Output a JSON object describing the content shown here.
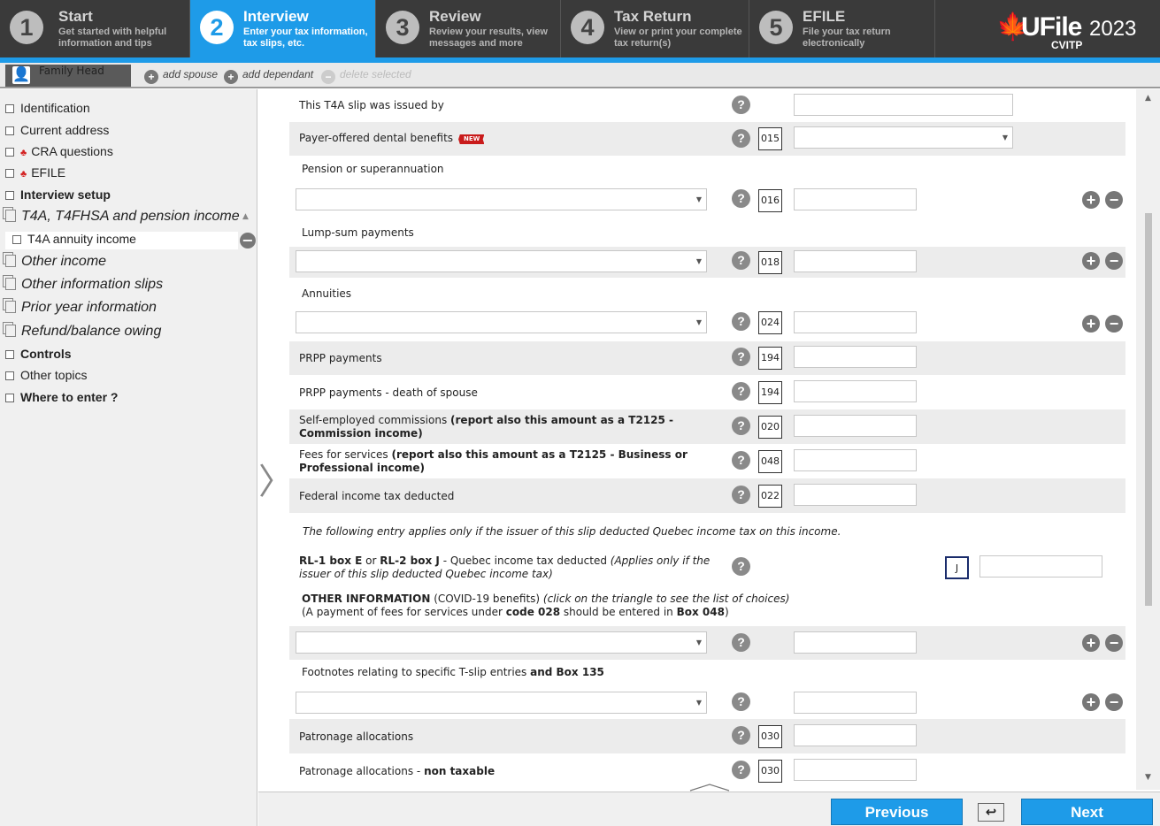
{
  "steps": [
    {
      "num": "1",
      "title": "Start",
      "sub": "Get started with helpful\ninformation and tips"
    },
    {
      "num": "2",
      "title": "Interview",
      "sub": "Enter your tax information,\ntax slips, etc."
    },
    {
      "num": "3",
      "title": "Review",
      "sub": "Review your results, view\nmessages and more"
    },
    {
      "num": "4",
      "title": "Tax Return",
      "sub": "View or print your complete\ntax return(s)"
    },
    {
      "num": "5",
      "title": "EFILE",
      "sub": "File your tax return\nelectronically"
    }
  ],
  "brand": {
    "name": "UFile",
    "year": "2023",
    "sub": "CVITP",
    "accent": "#1e9be8",
    "leaf": "#d32020"
  },
  "family": {
    "tab": "Family Head",
    "add_spouse": "add spouse",
    "add_dependant": "add dependant",
    "delete_selected": "delete selected"
  },
  "sidebar": {
    "items": [
      {
        "label": "Identification"
      },
      {
        "label": "Current address"
      },
      {
        "label": "CRA questions"
      },
      {
        "label": "EFILE"
      },
      {
        "label": "Interview setup"
      },
      {
        "label": "T4A, T4FHSA and pension income"
      },
      {
        "label": "T4A annuity income"
      },
      {
        "label": "Other income"
      },
      {
        "label": "Other information slips"
      },
      {
        "label": "Prior year information"
      },
      {
        "label": "Refund/balance owing"
      },
      {
        "label": "Controls"
      },
      {
        "label": "Other topics"
      },
      {
        "label": "Where to enter ?"
      }
    ]
  },
  "form": {
    "issued_by": "This T4A slip was issued by",
    "dental": "Payer-offered dental benefits",
    "new_badge": "NEW",
    "pension": "Pension or superannuation",
    "lump": "Lump-sum payments",
    "annuities": "Annuities",
    "prpp": "PRPP payments",
    "prpp_death": "PRPP payments - death of spouse",
    "self_emp": "Self-employed commissions ",
    "self_emp_b": "(report also this amount as a T2125 - Commission income)",
    "fees": "Fees for services ",
    "fees_b": "(report also this amount as a T2125 - Business or Professional income)",
    "fed_tax": "Federal income tax deducted",
    "quebec_note": "The following entry applies only if the issuer of this slip deducted Quebec income tax on this income.",
    "rl_1": "RL-1 box E",
    "rl_or": " or ",
    "rl_2": "RL-2 box J",
    "rl_rest": " - Quebec income tax deducted ",
    "rl_italic": "(Applies only if the issuer of this slip deducted Quebec income tax)",
    "other_info_b": "OTHER INFORMATION",
    "other_info": " (COVID-19 benefits) ",
    "other_info_i": " (click on the triangle to see the list of choices)",
    "other_info2a": "(A payment of fees for services under ",
    "other_info2b": "code 028",
    "other_info2c": " should be entered in ",
    "other_info2d": "Box 048",
    "other_info2e": ")",
    "footnotes": "Footnotes relating to specific T-slip entries ",
    "footnotes_b": "and Box 135",
    "patronage": "Patronage allocations",
    "patronage_nt": "Patronage allocations - ",
    "patronage_nt_b": "non taxable",
    "codes": {
      "c015": "015",
      "c016": "016",
      "c018": "018",
      "c024": "024",
      "c194a": "194",
      "c194b": "194",
      "c020": "020",
      "c048": "048",
      "c022": "022",
      "cJ": "J",
      "c030a": "030",
      "c030b": "030"
    }
  },
  "buttons": {
    "previous": "Previous",
    "next": "Next"
  }
}
